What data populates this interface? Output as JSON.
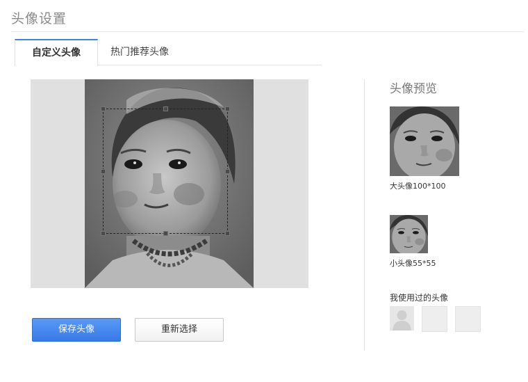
{
  "page": {
    "title": "头像设置"
  },
  "tabs": [
    {
      "label": "自定义头像",
      "active": true
    },
    {
      "label": "热门推荐头像",
      "active": false
    }
  ],
  "editor": {
    "save_label": "保存头像",
    "reselect_label": "重新选择"
  },
  "preview": {
    "title": "头像预览",
    "large_caption": "大头像100*100",
    "small_caption": "小头像55*55"
  },
  "used": {
    "title": "我使用过的头像",
    "avatars": [
      "default-user-icon",
      "empty",
      "empty"
    ]
  },
  "colors": {
    "accent": "#3b86e8",
    "save_button": "#3679e6",
    "title_text": "#8a8a8a"
  }
}
